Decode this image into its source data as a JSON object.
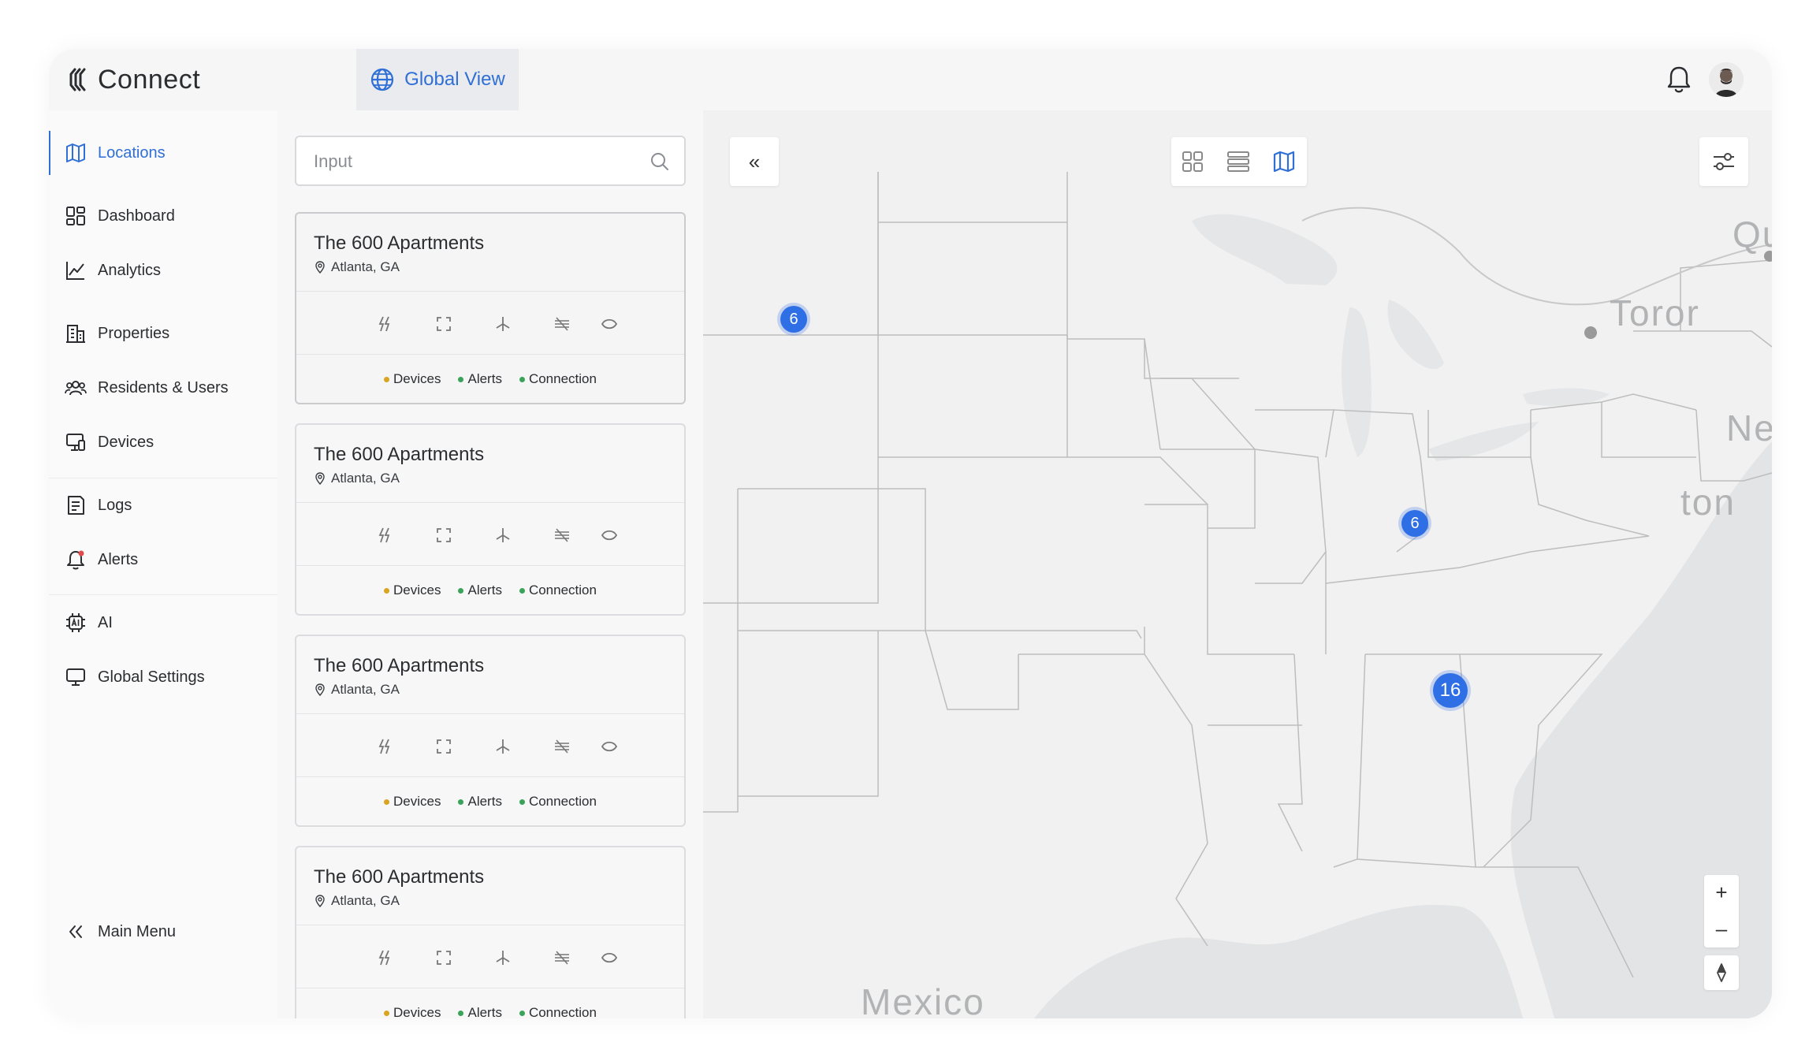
{
  "app": {
    "brand": "Connect"
  },
  "header": {
    "tab_global_view": "Global View"
  },
  "sidebar": {
    "items": [
      {
        "label": "Locations",
        "icon": "map-icon"
      },
      {
        "label": "Dashboard",
        "icon": "grid-icon"
      },
      {
        "label": "Analytics",
        "icon": "chart-line-icon"
      },
      {
        "label": "Properties",
        "icon": "building-icon"
      },
      {
        "label": "Residents & Users",
        "icon": "users-icon"
      },
      {
        "label": "Devices",
        "icon": "devices-icon"
      },
      {
        "label": "Logs",
        "icon": "log-icon"
      },
      {
        "label": "Alerts",
        "icon": "bell-alert-icon"
      },
      {
        "label": "AI",
        "icon": "ai-chip-icon"
      },
      {
        "label": "Global Settings",
        "icon": "settings-monitor-icon"
      }
    ],
    "main_menu": "Main Menu"
  },
  "list": {
    "search_placeholder": "Input",
    "cards": [
      {
        "title": "The 600 Apartments",
        "location": "Atlanta, GA"
      },
      {
        "title": "The 600 Apartments",
        "location": "Atlanta, GA"
      },
      {
        "title": "The 600 Apartments",
        "location": "Atlanta, GA"
      },
      {
        "title": "The 600 Apartments",
        "location": "Atlanta, GA"
      }
    ],
    "legend": {
      "devices": "Devices",
      "alerts": "Alerts",
      "connection": "Connection"
    },
    "legend_colors": {
      "devices": "#d9a520",
      "alerts": "#3aa35a",
      "connection": "#3aa35a"
    }
  },
  "map": {
    "collapse_symbol": "«",
    "clusters": [
      "6",
      "6",
      "16"
    ],
    "labels": [
      "Que",
      "Toror",
      "New",
      "ton",
      "Mexico"
    ],
    "zoom_in": "+",
    "zoom_out": "–"
  },
  "colors": {
    "accent": "#2f6fd6",
    "cluster": "#2f6fe6"
  }
}
